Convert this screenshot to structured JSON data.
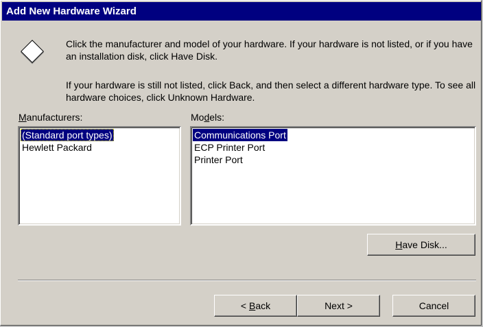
{
  "window": {
    "title": "Add New Hardware Wizard"
  },
  "instructions": {
    "paragraph1": "Click the manufacturer and model of your hardware. If your hardware is not listed, or if you have an installation disk, click Have Disk.",
    "paragraph2": "If your hardware is still not listed, click Back, and then select a different hardware type. To see all hardware choices, click Unknown Hardware."
  },
  "manufacturers": {
    "label_prefix": "",
    "label_accel": "M",
    "label_suffix": "anufacturers:",
    "items": [
      {
        "label": "(Standard port types)",
        "selected": true
      },
      {
        "label": "Hewlett Packard",
        "selected": false
      }
    ]
  },
  "models": {
    "label_prefix": "Mo",
    "label_accel": "d",
    "label_suffix": "els:",
    "items": [
      {
        "label": "Communications Port",
        "selected": true
      },
      {
        "label": "ECP Printer Port",
        "selected": false
      },
      {
        "label": "Printer Port",
        "selected": false
      }
    ]
  },
  "buttons": {
    "have_disk_accel": "H",
    "have_disk_rest": "ave Disk...",
    "back_arrow": "< ",
    "back_accel": "B",
    "back_rest": "ack",
    "next": "Next >",
    "cancel": "Cancel"
  }
}
